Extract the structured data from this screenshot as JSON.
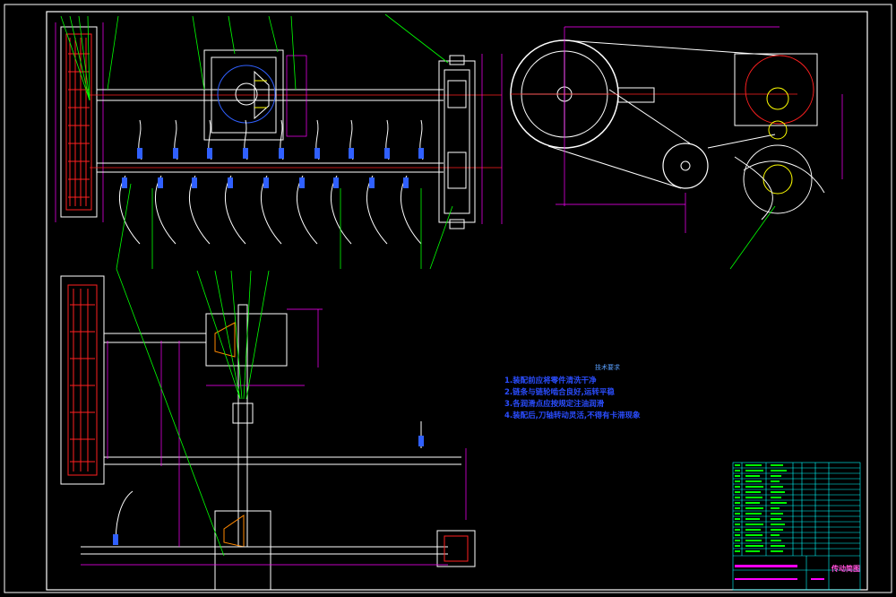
{
  "notes": {
    "title": "技术要求",
    "lines": [
      "1.装配前应将零件清洗干净",
      "2.链条与链轮啮合良好,运转平稳",
      "3.各润滑点应按规定注油润滑",
      "4.装配后,刀轴转动灵活,不得有卡滞现象"
    ]
  },
  "title_block": {
    "drawing_name": "传动简图"
  },
  "colors": {
    "background": "#000000",
    "frame": "#ffffff",
    "leader": "#00ff00",
    "dimension": "#ff00ff",
    "parts": "#ffffff",
    "chain": "#ff2020",
    "notes_text": "#2a4dff",
    "table": "#00ffff"
  }
}
